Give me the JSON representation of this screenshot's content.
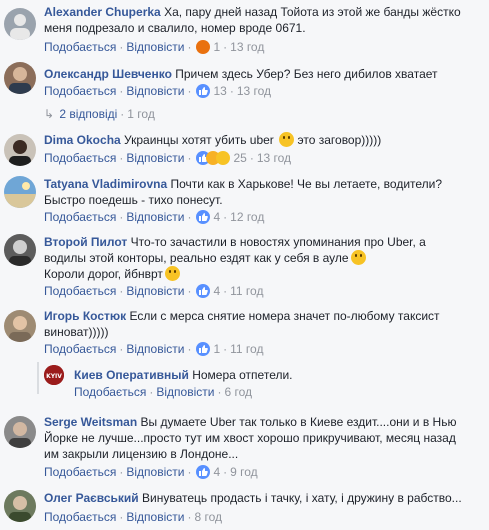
{
  "labels": {
    "like": "Подобається",
    "reply": "Відповісти",
    "dot": "·"
  },
  "colors": {
    "author": "#365899",
    "meta": "#90949c",
    "like_badge": "#5890ff",
    "angry_badge": "#e9710f",
    "haha_badge": "#f7b125"
  },
  "comments": [
    {
      "author": "Alexander Chuperka",
      "text": "Ха, пару дней назад Тойота из этой же банды жёстко меня подрезало и свалило, номер вроде 0671.",
      "reactions": [
        "angry"
      ],
      "count": "1",
      "time": "13 год"
    },
    {
      "author": "Олександр Шевченко",
      "text": "Причем здесь Убер? Без него дибилов хватает",
      "reactions": [
        "like"
      ],
      "count": "13",
      "time": "13 год"
    },
    {
      "author": "Dima Okocha",
      "text": "Украинцы хотят убить uber",
      "text_after": "это заговор)))))",
      "reactions": [
        "like",
        "haha",
        "face"
      ],
      "count": "25",
      "time": "13 год"
    },
    {
      "author": "Tatyana Vladimirovna",
      "text": "Почти как в Харькове! Че вы летаете, водители? Быстро поедешь - тихо понесут.",
      "reactions": [
        "like"
      ],
      "count": "4",
      "time": "12 год"
    },
    {
      "author": "Второй Пилот",
      "text": "Что-то зачастили в новостях упоминания про Uber, а водилы этой конторы, реально ездят как у себя в ауле",
      "text_line2": "Короли дорог, йбнврт",
      "reactions": [
        "like"
      ],
      "count": "4",
      "time": "11 год"
    },
    {
      "author": "Игорь Костюк",
      "text": "Если с мерса снятие номера значет по-любому таксист виноват)))))",
      "reactions": [
        "like"
      ],
      "count": "1",
      "time": "11 год"
    },
    {
      "author": "Киев Оперативный",
      "text": "Номера отпетели.",
      "reactions": [],
      "count": "",
      "time": "6 год"
    },
    {
      "author": "Serge Weitsman",
      "text": "Вы думаете Uber так только в Киеве ездит....они и в Нью Йорке не лучше...просто тут им хвост хорошо прикручивают, месяц назад им закрыли лицензию в Лондоне...",
      "reactions": [
        "like"
      ],
      "count": "4",
      "time": "9 год"
    },
    {
      "author": "Олег Раєвський",
      "text": "Винуватець продасть і тачку, і хату, і дружину в рабство...",
      "reactions": [],
      "count": "",
      "time": "8 год"
    }
  ],
  "replies_link": {
    "text": "2 відповіді",
    "time": "1 год"
  },
  "avatar_badge": "KYIV"
}
